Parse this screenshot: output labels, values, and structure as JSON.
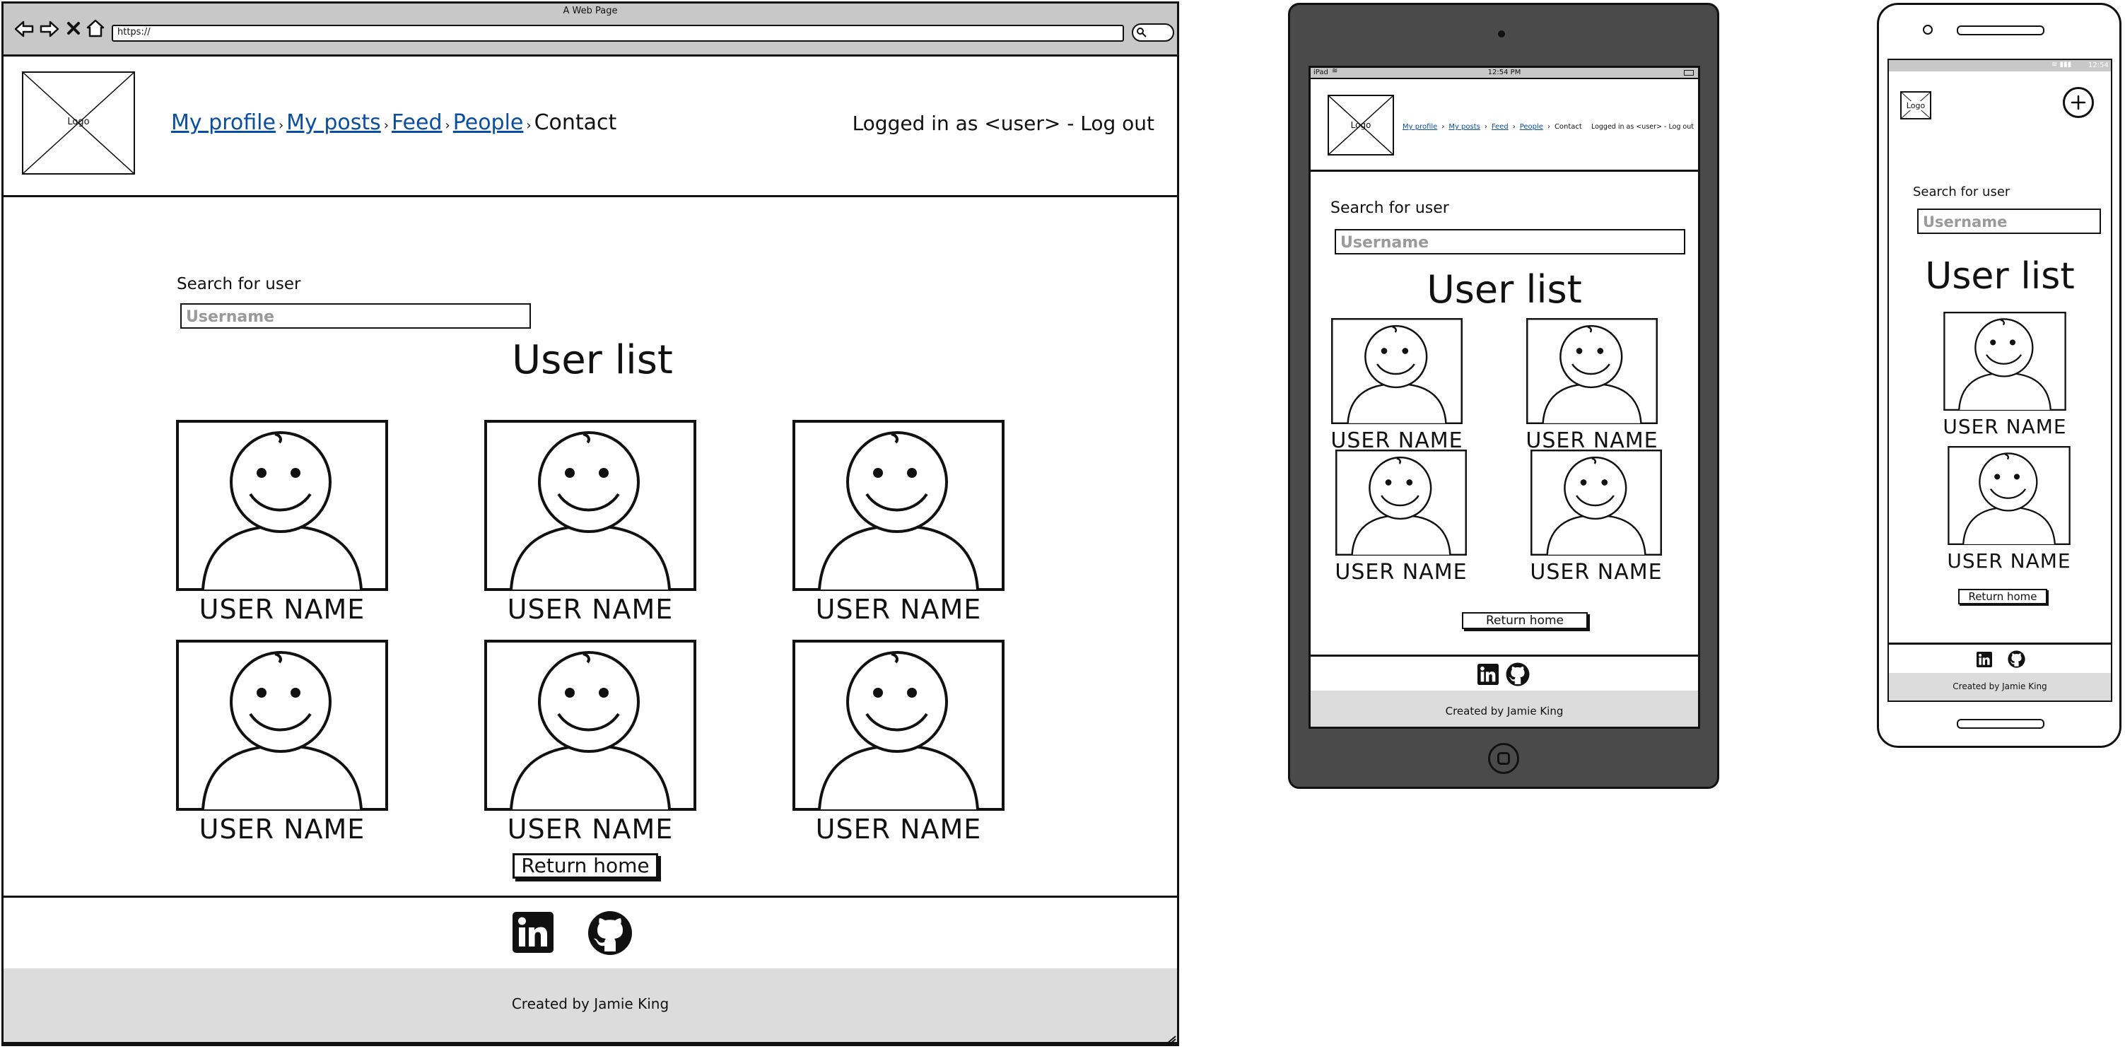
{
  "desktop": {
    "browser": {
      "title": "A Web Page",
      "url": "https://"
    },
    "logo": "Logo",
    "nav": [
      {
        "label": "My profile",
        "link": true
      },
      {
        "label": "My posts",
        "link": true
      },
      {
        "label": "Feed",
        "link": true
      },
      {
        "label": "People",
        "link": true
      },
      {
        "label": "Contact",
        "link": false
      }
    ],
    "separator": "›",
    "login": "Logged in as <user> - Log out",
    "search_label": "Search for user",
    "search_placeholder": "Username",
    "heading": "User list",
    "users": [
      "USER NAME",
      "USER NAME",
      "USER NAME",
      "USER NAME",
      "USER NAME",
      "USER NAME"
    ],
    "return_button": "Return home",
    "footer_credit": "Created by Jamie King",
    "social_icons": [
      "linkedin-icon",
      "github-icon"
    ]
  },
  "tablet": {
    "status": {
      "carrier": "iPad",
      "time": "12:54 PM"
    },
    "logo": "Logo",
    "nav": [
      {
        "label": "My profile",
        "link": true
      },
      {
        "label": "My posts",
        "link": true
      },
      {
        "label": "Feed",
        "link": true
      },
      {
        "label": "People",
        "link": true
      },
      {
        "label": "Contact",
        "link": false
      }
    ],
    "separator": "›",
    "login": "Logged in as <user> - Log out",
    "search_label": "Search for user",
    "search_placeholder": "Username",
    "heading": "User list",
    "users": [
      "USER NAME",
      "USER NAME",
      "USER NAME",
      "USER NAME"
    ],
    "return_button": "Return home",
    "footer_credit": "Created by Jamie King"
  },
  "phone": {
    "status": {
      "time": "12:54"
    },
    "logo": "Logo",
    "search_label": "Search for user",
    "search_placeholder": "Username",
    "heading": "User list",
    "users": [
      "USER NAME",
      "USER NAME"
    ],
    "return_button": "Return home",
    "footer_credit": "Created by Jamie King"
  },
  "colors": {
    "link": "#0a4ea3",
    "ink": "#111111",
    "chrome_gray": "#c8c8c8",
    "footer_gray": "#dcdcdc",
    "tablet_body": "#4a4a4a"
  }
}
